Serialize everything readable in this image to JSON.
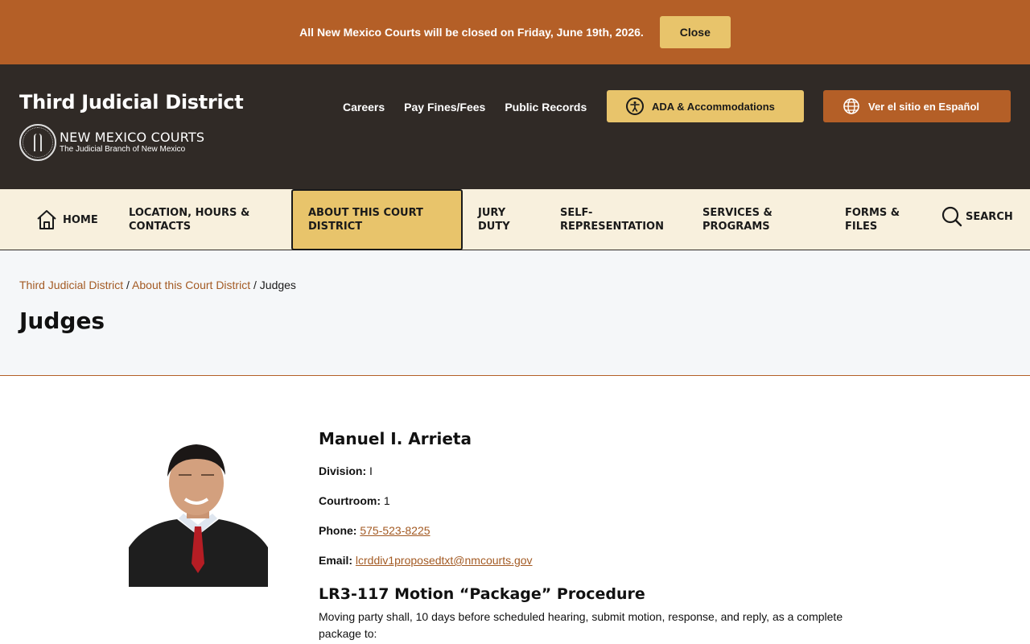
{
  "alert": {
    "message": "All New Mexico Courts will be closed on Friday, June 19th, 2026.",
    "close_label": "Close"
  },
  "header": {
    "site_title": "Third Judicial District",
    "logo_name": "NEW MEXICO COURTS",
    "logo_tagline": "The Judicial Branch of New Mexico",
    "utility_links": [
      "Careers",
      "Pay Fines/Fees",
      "Public Records"
    ],
    "ada_label": "ADA & Accommodations",
    "spanish_label": "Ver el sitio en Español"
  },
  "nav": {
    "home": "HOME",
    "location": "LOCATION, HOURS & CONTACTS",
    "about": "ABOUT THIS COURT DISTRICT",
    "jury": "JURY DUTY",
    "self_rep": "SELF-REPRESENTATION",
    "services": "SERVICES & PROGRAMS",
    "forms": "FORMS & FILES",
    "search": "SEARCH"
  },
  "breadcrumb": {
    "items": [
      "Third Judicial District",
      "About this Court District"
    ],
    "current": "Judges",
    "separator": "/"
  },
  "page_title": "Judges",
  "judge": {
    "name": "Manuel I. Arrieta",
    "division_label": "Division:",
    "division": "I",
    "courtroom_label": "Courtroom:",
    "courtroom": "1",
    "phone_label": "Phone:",
    "phone": "575-523-8225",
    "email_label": "Email:",
    "email": "lcrddiv1proposedtxt@nmcourts.gov"
  },
  "procedure": {
    "title": "LR3-117 Motion “Package” Procedure",
    "text": "Moving party shall, 10 days before scheduled hearing, submit motion, response, and reply, as a complete package to:"
  },
  "colors": {
    "brand_orange": "#b45f27",
    "gold": "#e8c46b",
    "header_dark": "#302a26",
    "nav_bg": "#f8f0dd"
  }
}
